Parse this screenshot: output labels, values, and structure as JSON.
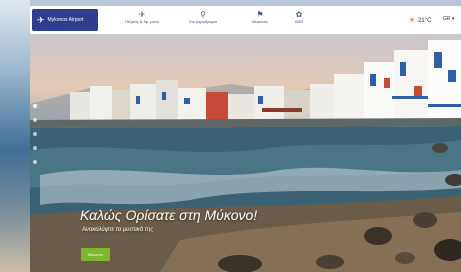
{
  "nav": {
    "logo_text": "Mykonos Airport",
    "items": [
      {
        "label": "Πτήσεις & δρ. μόνο",
        "icon": "plane-icon"
      },
      {
        "label": "Στο Αεροδρόμιο",
        "icon": "walking-person-icon"
      },
      {
        "label": "Μύκονος",
        "icon": "map-pin-icon"
      },
      {
        "label": "B2B",
        "icon": "handshake-icon"
      }
    ],
    "weather": "21°C",
    "language": "GR"
  },
  "hero": {
    "title": "Καλώς Ορίσατε στη Μύκονο!",
    "subtitle": "Ανακαλύψτε τα μυστικά της",
    "cta": "Μύκονος"
  },
  "slider": {
    "count": 5,
    "active": 0
  }
}
